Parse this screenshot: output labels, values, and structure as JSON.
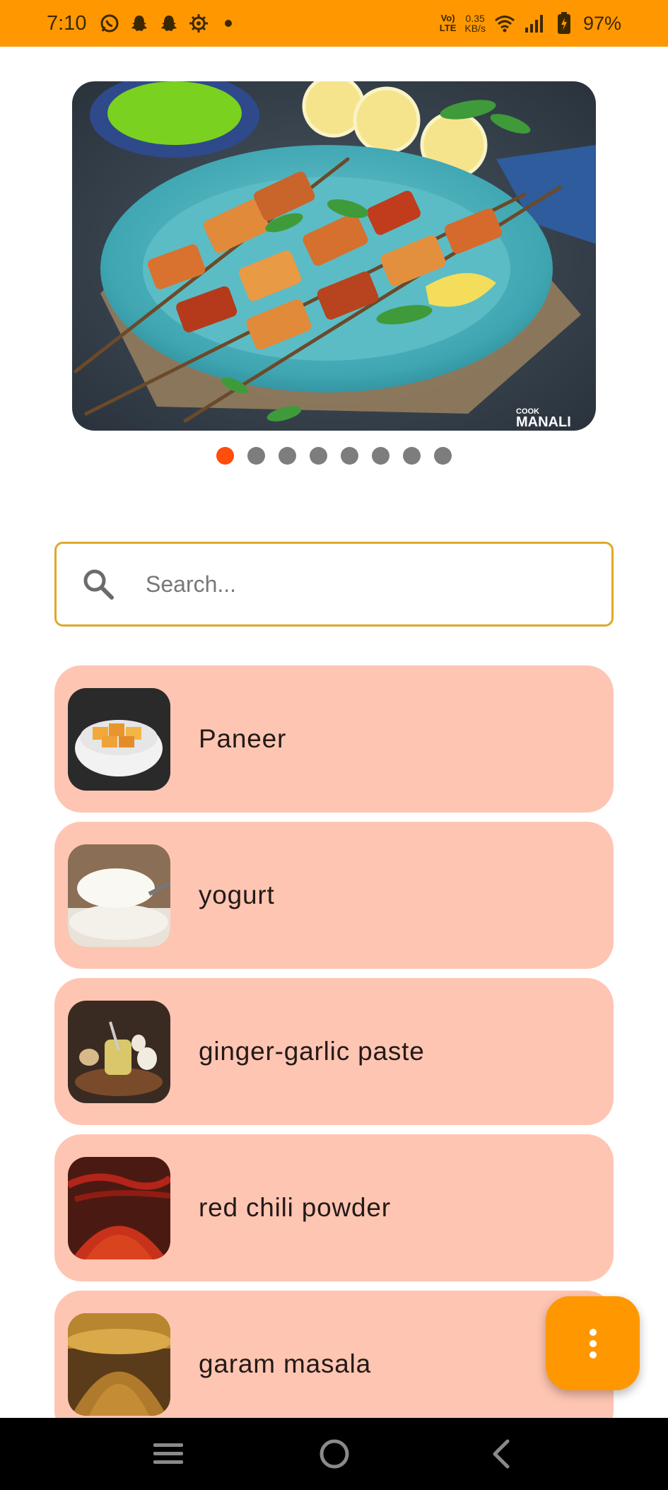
{
  "status_bar": {
    "time": "7:10",
    "left_icons": [
      "whatsapp-icon",
      "snapchat-icon",
      "snapchat-icon",
      "settings-icon",
      "dot-icon"
    ],
    "volte_top": "Vo)",
    "volte_bottom": "LTE",
    "speed_top": "0.35",
    "speed_bottom": "KB/s",
    "battery": "97%"
  },
  "carousel": {
    "image_label": "paneer tikka skewers on blue plate",
    "watermark_top": "COOK",
    "watermark_bottom": "MANALI",
    "slide_count": 8,
    "active_index": 0
  },
  "search": {
    "placeholder": "Search..."
  },
  "ingredients": [
    {
      "name": "Paneer",
      "thumb": "paneer-bowl"
    },
    {
      "name": "yogurt",
      "thumb": "yogurt-spoon"
    },
    {
      "name": "ginger-garlic paste",
      "thumb": "ginger-garlic-basket"
    },
    {
      "name": "red chili powder",
      "thumb": "chili-powder-pile"
    },
    {
      "name": "garam masala",
      "thumb": "garam-masala-pile"
    }
  ],
  "fab": {
    "icon": "more-vertical-icon"
  },
  "colors": {
    "status_bar": "#ff9800",
    "card": "#ffc5b3",
    "search_border": "#e0a82a",
    "dot_active": "#ff4d0a",
    "dot_inactive": "#7d7d7d",
    "fab": "#ff9800"
  }
}
